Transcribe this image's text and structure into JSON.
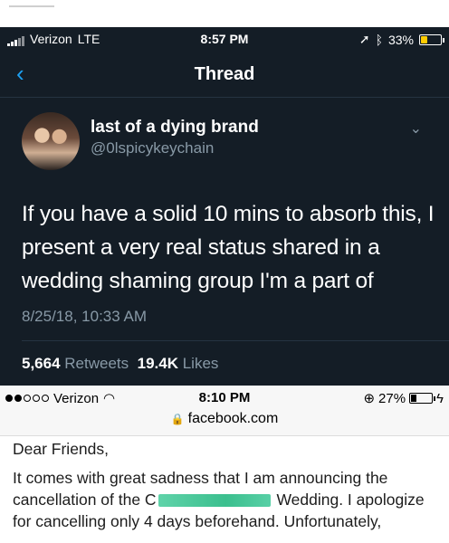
{
  "twitter": {
    "status_bar": {
      "carrier": "Verizon",
      "network": "LTE",
      "time": "8:57 PM",
      "battery": "33%",
      "battery_level": 0.33,
      "icons": [
        "signal-bars-icon",
        "location-arrow-icon",
        "bluetooth-icon",
        "battery-icon"
      ]
    },
    "nav": {
      "back_glyph": "‹",
      "title": "Thread"
    },
    "tweet": {
      "display_name": "last of a dying brand",
      "handle": "@0lspicykeychain",
      "text": "If you have a solid 10 mins to absorb this, I present a very real status shared in a wedding shaming group I'm a part of",
      "timestamp": "8/25/18, 10:33 AM",
      "retweets_count": "5,664",
      "retweets_label": "Retweets",
      "likes_count": "19.4K",
      "likes_label": "Likes"
    },
    "colors": {
      "background": "#141d26",
      "accent": "#1da1f2",
      "muted": "#8899a6",
      "battery": "#ffcc00"
    }
  },
  "facebook": {
    "status_bar": {
      "carrier": "Verizon",
      "time": "8:10 PM",
      "battery": "27%",
      "battery_level": 0.27,
      "url": "facebook.com",
      "icons": [
        "signal-dots-icon",
        "wifi-icon",
        "rotation-lock-icon",
        "battery-icon",
        "charging-icon",
        "lock-icon"
      ]
    },
    "post": {
      "greeting": "Dear Friends,",
      "line_part1": "It comes with great sadness that I am announcing the cancellation of the C",
      "line_part2": "Wedding. I apologize for cancelling only 4 days beforehand. Unfortunately,"
    },
    "colors": {
      "redaction": "#3bbf8e"
    }
  }
}
